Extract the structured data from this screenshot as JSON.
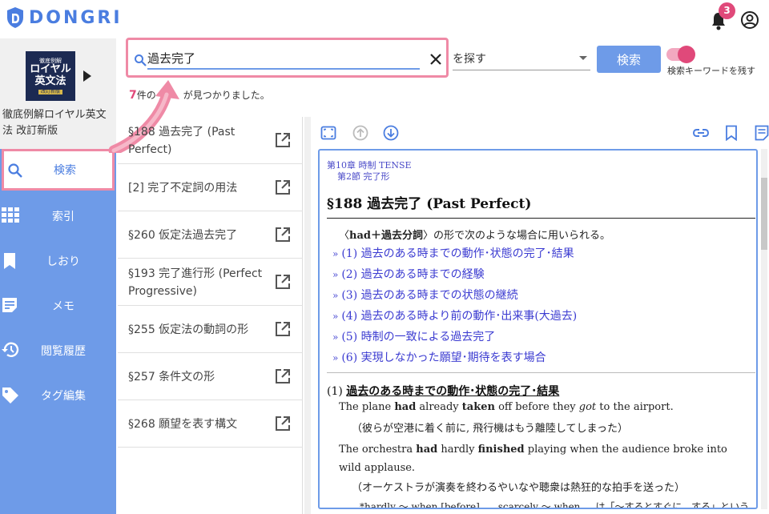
{
  "app": {
    "name": "DONGRI",
    "notifications": "3"
  },
  "sidebar": {
    "book_title": "徹底例解ロイヤル英文法 改訂新版",
    "cover": {
      "line1": "徹底例解",
      "line2": "ロイヤル",
      "line3": "英文法",
      "tag": "改訂新版"
    },
    "nav": [
      {
        "label": "検索",
        "icon": "search-icon"
      },
      {
        "label": "索引",
        "icon": "grid-icon"
      },
      {
        "label": "しおり",
        "icon": "bookmark-icon"
      },
      {
        "label": "メモ",
        "icon": "memo-icon"
      },
      {
        "label": "閲覧履歴",
        "icon": "history-icon"
      },
      {
        "label": "タグ編集",
        "icon": "tag-icon"
      }
    ]
  },
  "search": {
    "query": "過去完了",
    "target": "を探す",
    "button": "検索",
    "keep_keyword_label": "検索キーワードを残す",
    "result_count": "7",
    "result_suffix_a": "件の",
    "result_suffix_b": "が見つかりました。"
  },
  "results": [
    "§188 過去完了 (Past Perfect)",
    "[2] 完了不定詞の用法",
    "§260 仮定法過去完了",
    "§193 完了進行形 (Perfect Progressive)",
    "§255 仮定法の動詞の形",
    "§257 条件文の形",
    "§268 願望を表す構文"
  ],
  "detail": {
    "chapter": "第10章 時制 TENSE",
    "section": "第2節 完了形",
    "title": "§188 過去完了 (Past Perfect)",
    "intro_a": "〈",
    "intro_b": "had",
    "intro_c": "＋過去分詞",
    "intro_d": "〉の形で次のような場合に用いられる。",
    "links": [
      "(1) 過去のある時までの動作･状態の完了･結果",
      "(2) 過去のある時までの経験",
      "(3) 過去のある時までの状態の継続",
      "(4) 過去のある時より前の動作･出来事(大過去)",
      "(5) 時制の一致による過去完了",
      "(6) 実現しなかった願望･期待を表す場合"
    ],
    "heading_num": "(1) ",
    "heading": "過去のある時までの動作･状態の完了･結果",
    "ex1": {
      "a": "The plane ",
      "b": "had",
      "c": " already ",
      "d": "taken",
      "e": " off before they ",
      "f": "got",
      "g": " to the airport."
    },
    "tr1": "（彼らが空港に着く前に, 飛行機はもう離陸してしまった）",
    "ex2": {
      "a": "The orchestra ",
      "b": "had",
      "c": " hardly ",
      "d": "finished",
      "e": " playing when the audience broke into wild applause."
    },
    "tr2": "（オーケストラが演奏を終わるやいなや聴衆は熱狂的な拍手を送った）",
    "note": "*hardly ～ when [before] ..., scarcely ～ when ... は「～するとすぐに…する」という"
  },
  "colors": {
    "accent": "#4a7de0",
    "nav_bg": "#6e9be8",
    "highlight": "#ef8aa6",
    "badge": "#e0497a",
    "link": "#3b3bd1"
  }
}
